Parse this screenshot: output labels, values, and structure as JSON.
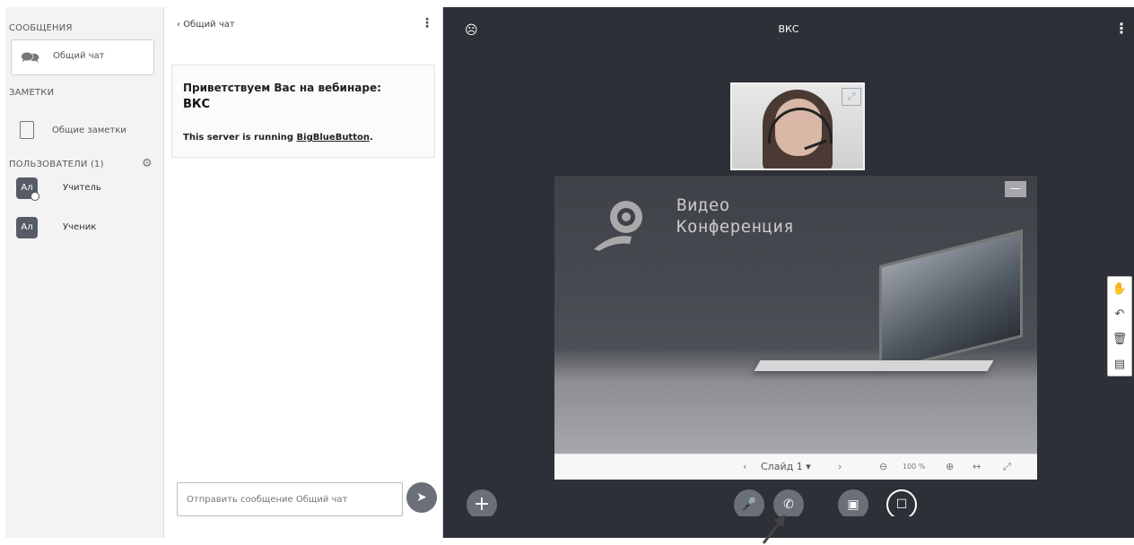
{
  "sidebar": {
    "messages_title": "СООБЩЕНИЯ",
    "public_chat_label": "Общий чат",
    "notes_title": "ЗАМЕТКИ",
    "shared_notes_label": "Общие заметки",
    "users_title": "ПОЛЬЗОВАТЕЛИ (1)",
    "users": [
      {
        "name": "Учитель",
        "initials": "Ал"
      },
      {
        "name": "Ученик",
        "initials": "Ал"
      }
    ]
  },
  "chat": {
    "header": "Общий чат",
    "welcome_line1": "Приветствуем Вас на вебинаре:",
    "welcome_line2": "ВКС",
    "server_prefix": "This server is running ",
    "server_link": "BigBlueButton",
    "server_suffix": ".",
    "input_placeholder": "Отправить сообщение Общий чат"
  },
  "main": {
    "title": "ВКС",
    "slide": {
      "logo_line1": "Видео",
      "logo_line2": "Конференция",
      "slide_label": "Слайд 1",
      "zoom": "100 %"
    }
  },
  "colors": {
    "main_bg": "#2e3038",
    "button_bg": "#6b6f77",
    "sidebar_bg": "#f3f3f3"
  }
}
